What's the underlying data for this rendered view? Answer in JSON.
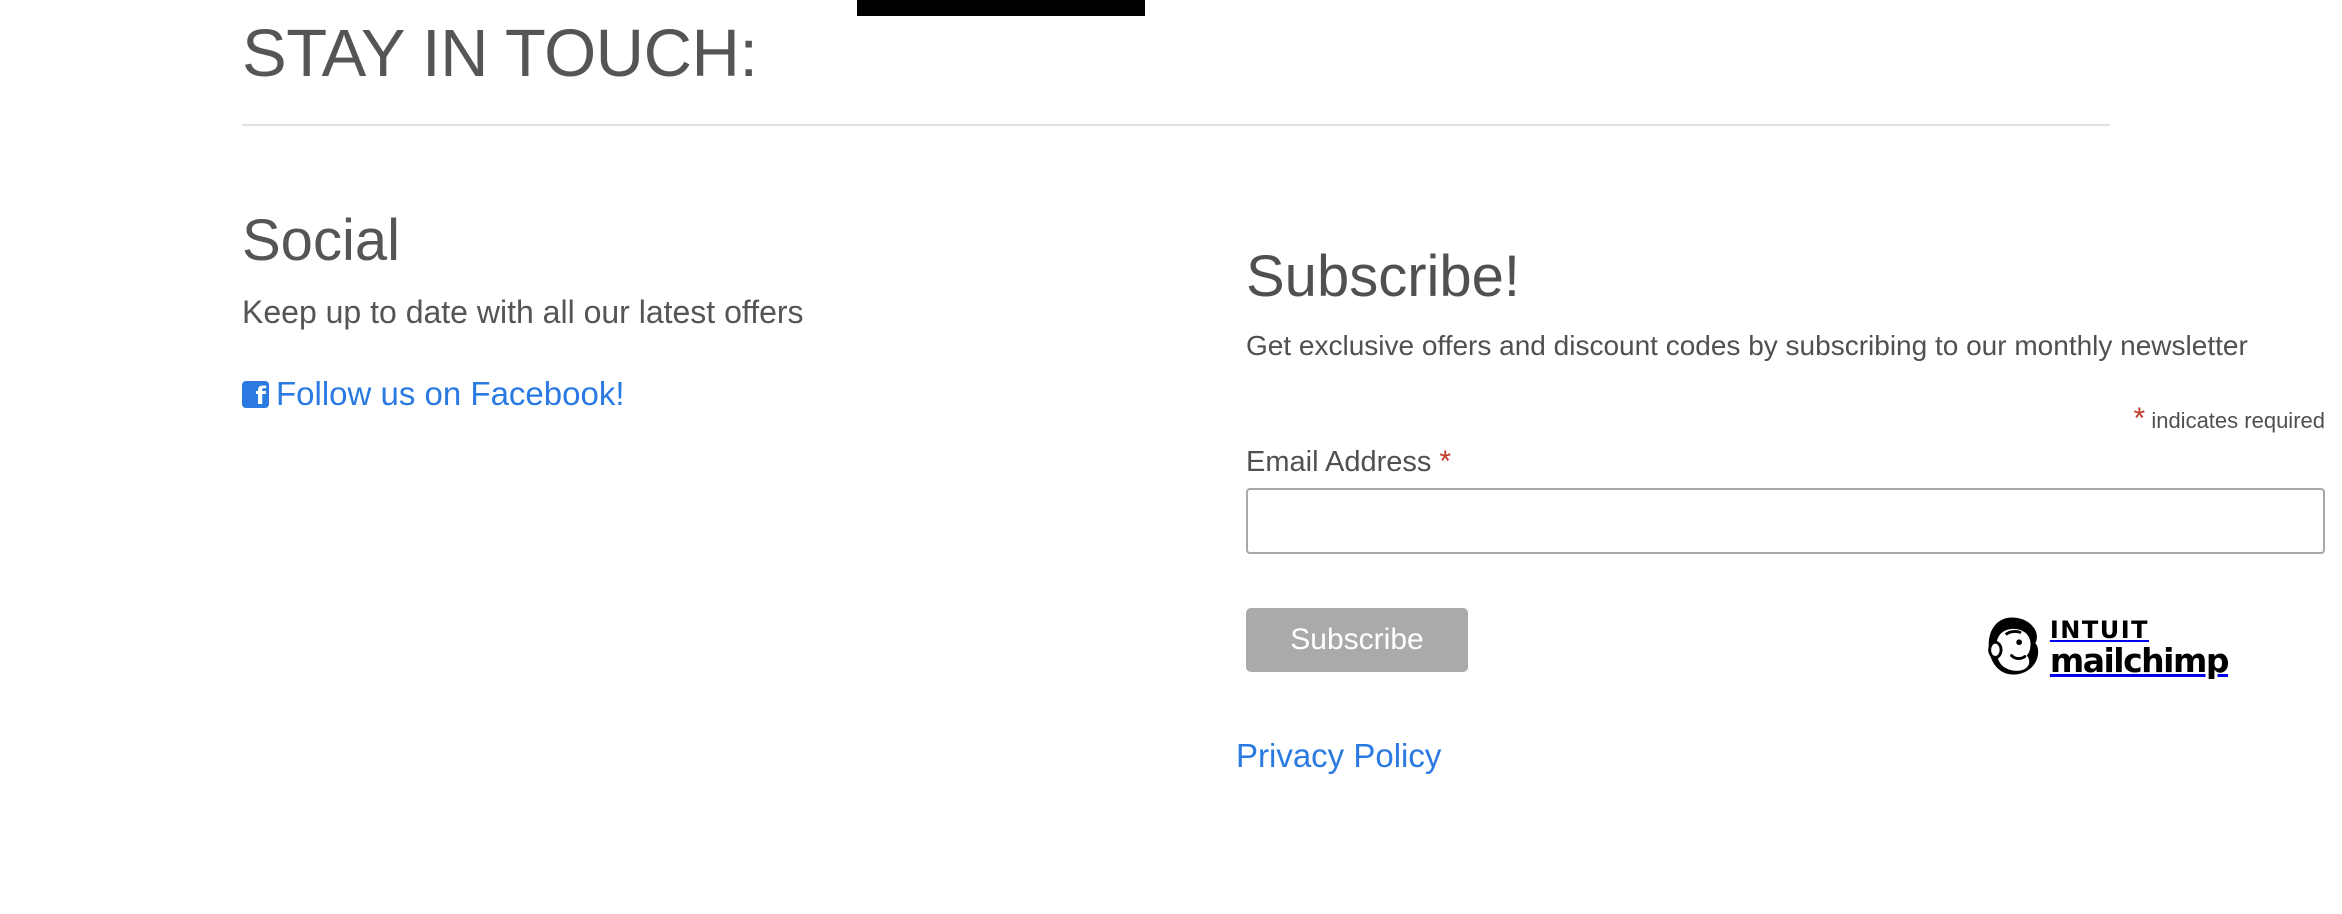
{
  "section_title": "STAY IN TOUCH:",
  "social": {
    "heading": "Social",
    "text": "Keep up to date with all our latest offers",
    "facebook_link": "Follow us on Facebook!",
    "facebook_icon": "facebook-square-icon"
  },
  "subscribe": {
    "heading": "Subscribe!",
    "text": "Get exclusive offers and discount codes by subscribing to our monthly newsletter",
    "required_asterisk": "*",
    "required_note": "indicates required",
    "email_label": "Email Address",
    "email_value": "",
    "button_label": "Subscribe"
  },
  "badge": {
    "line1": "INTUIT",
    "line2": "mailchimp",
    "icon": "mailchimp-freddie-icon"
  },
  "privacy_link": "Privacy Policy",
  "colors": {
    "link": "#2a7ae2",
    "text": "#505050",
    "button": "#aaaaaa",
    "required": "#c0392b"
  }
}
